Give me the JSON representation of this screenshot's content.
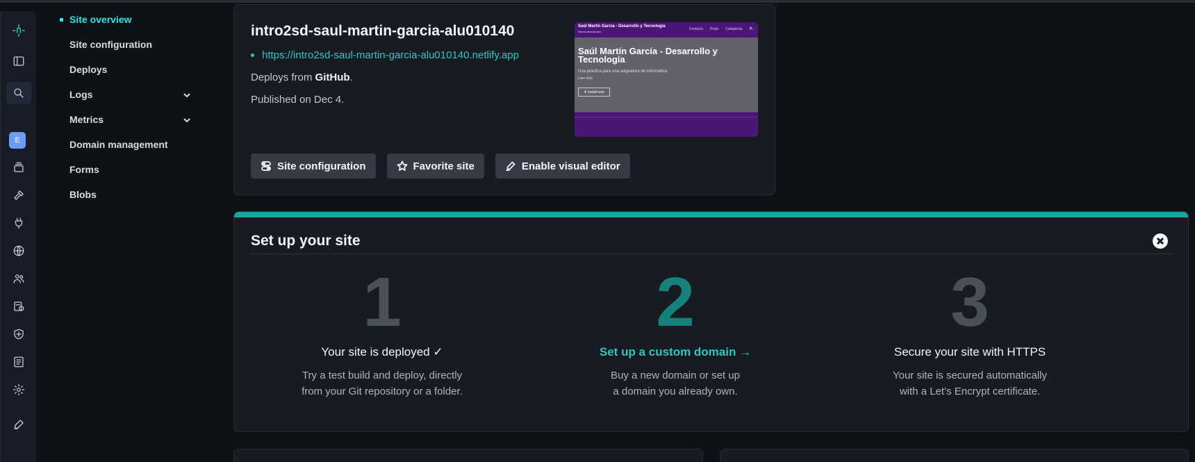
{
  "colors": {
    "accent": "#32e6e2",
    "teal": "#1aa4a0",
    "card": "#181b22",
    "bg": "#0e1116"
  },
  "rail": {
    "icons": [
      "netlify-logo-icon",
      "sidebar-toggle-icon",
      "search-icon",
      "team-avatar",
      "sites-icon",
      "builds-icon",
      "integrations-icon",
      "domains-icon",
      "members-icon",
      "audit-icon",
      "security-icon",
      "logs-icon",
      "settings-icon",
      "edit-icon"
    ],
    "avatar_letter": "E"
  },
  "subnav": {
    "items": [
      {
        "label": "Site overview"
      },
      {
        "label": "Site configuration"
      },
      {
        "label": "Deploys"
      },
      {
        "label": "Logs"
      },
      {
        "label": "Metrics"
      },
      {
        "label": "Domain management"
      },
      {
        "label": "Forms"
      },
      {
        "label": "Blobs"
      }
    ]
  },
  "site": {
    "name": "intro2sd-saul-martin-garcia-alu010140",
    "url": "https://intro2sd-saul-martin-garcia-alu010140.netlify.app",
    "deploys_prefix": "Deploys from ",
    "deploys_source": "GitHub",
    "deploys_suffix": ".",
    "published": "Published on Dec 4.",
    "preview": {
      "brand": "Saúl Martín García - Desarrollo y Tecnología",
      "brand_sub": "Nueva descripcion",
      "nav": [
        "Contacto",
        "Posts",
        "Categorías",
        "🔍"
      ],
      "title": "Saúl Martín García - Desarrollo y Tecnología",
      "text": "Una práctica para una asignatura de Informática",
      "text2": "Leer más",
      "button": "⬇ Install now"
    },
    "buttons": {
      "configuration": "Site configuration",
      "favorite": "Favorite site",
      "visual_editor": "Enable visual editor"
    }
  },
  "setup": {
    "title": "Set up your site",
    "steps": [
      {
        "number": "1",
        "heading": "Your site is deployed ✓",
        "desc1": "Try a test build and deploy, directly",
        "desc2": "from your Git repository or a folder."
      },
      {
        "number": "2",
        "heading": "Set up a custom domain →",
        "desc1": "Buy a new domain or set up",
        "desc2": "a domain you already own."
      },
      {
        "number": "3",
        "heading": "Secure your site with HTTPS",
        "desc1": "Your site is secured automatically",
        "desc2": "with a Let’s Encrypt certificate."
      }
    ]
  }
}
